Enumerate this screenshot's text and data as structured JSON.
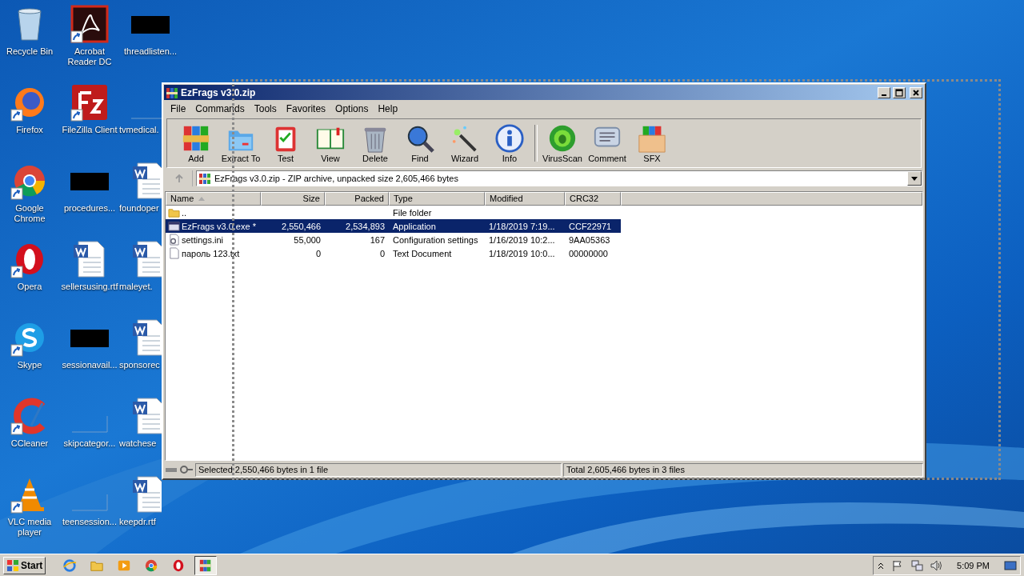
{
  "desktop_icons": [
    {
      "label": "Recycle Bin",
      "kind": "recycle",
      "shortcut": false
    },
    {
      "label": "Firefox",
      "kind": "firefox",
      "shortcut": true
    },
    {
      "label": "Google Chrome",
      "kind": "chrome",
      "shortcut": true
    },
    {
      "label": "Opera",
      "kind": "opera",
      "shortcut": true
    },
    {
      "label": "Skype",
      "kind": "skype",
      "shortcut": true
    },
    {
      "label": "CCleaner",
      "kind": "ccleaner",
      "shortcut": true
    },
    {
      "label": "VLC media player",
      "kind": "vlc",
      "shortcut": true
    },
    {
      "label": "Acrobat Reader DC",
      "kind": "acrobat",
      "shortcut": true
    },
    {
      "label": "FileZilla Client",
      "kind": "filezilla",
      "shortcut": true
    },
    {
      "label": "procedures...",
      "kind": "redacted",
      "shortcut": false
    },
    {
      "label": "sellersusing.rtf",
      "kind": "word",
      "shortcut": false
    },
    {
      "label": "sessionavail...",
      "kind": "redacted",
      "shortcut": false
    },
    {
      "label": "skipcategor...",
      "kind": "blank",
      "shortcut": false
    },
    {
      "label": "teensession...",
      "kind": "blank",
      "shortcut": false
    },
    {
      "label": "threadlisten...",
      "kind": "redacted",
      "shortcut": false
    },
    {
      "label": "tvmedical.",
      "kind": "blank",
      "shortcut": false
    },
    {
      "label": "foundoper",
      "kind": "word",
      "shortcut": false
    },
    {
      "label": "maleyet.",
      "kind": "word",
      "shortcut": false
    },
    {
      "label": "sponsorec",
      "kind": "word",
      "shortcut": false
    },
    {
      "label": "watchese",
      "kind": "word",
      "shortcut": false
    },
    {
      "label": "keepdr.rtf",
      "kind": "word",
      "shortcut": false
    }
  ],
  "window": {
    "title": "EzFrags v3.0.zip",
    "menu": [
      "File",
      "Commands",
      "Tools",
      "Favorites",
      "Options",
      "Help"
    ],
    "toolbar": {
      "groups": [
        {
          "buttons": [
            {
              "label": "Add",
              "kind": "add"
            },
            {
              "label": "Extract To",
              "kind": "extract"
            },
            {
              "label": "Test",
              "kind": "test"
            },
            {
              "label": "View",
              "kind": "view"
            },
            {
              "label": "Delete",
              "kind": "delete"
            },
            {
              "label": "Find",
              "kind": "find"
            },
            {
              "label": "Wizard",
              "kind": "wizard"
            },
            {
              "label": "Info",
              "kind": "info"
            }
          ]
        },
        {
          "buttons": [
            {
              "label": "VirusScan",
              "kind": "virus"
            },
            {
              "label": "Comment",
              "kind": "comment"
            },
            {
              "label": "SFX",
              "kind": "sfx"
            }
          ]
        }
      ]
    },
    "address": "EzFrags v3.0.zip - ZIP archive, unpacked size 2,605,466 bytes",
    "columns": [
      "Name",
      "Size",
      "Packed",
      "Type",
      "Modified",
      "CRC32"
    ],
    "rows": [
      {
        "kind": "folder",
        "name": "..",
        "size": "",
        "packed": "",
        "type": "File folder",
        "modified": "",
        "crc": "",
        "selected": false
      },
      {
        "kind": "app",
        "name": "EzFrags v3.0.exe *",
        "size": "2,550,466",
        "packed": "2,534,893",
        "type": "Application",
        "modified": "1/18/2019 7:19...",
        "crc": "CCF22971",
        "selected": true
      },
      {
        "kind": "ini",
        "name": "settings.ini",
        "size": "55,000",
        "packed": "167",
        "type": "Configuration settings",
        "modified": "1/16/2019 10:2...",
        "crc": "9AA05363",
        "selected": false
      },
      {
        "kind": "txt",
        "name": "пароль 123.txt",
        "size": "0",
        "packed": "0",
        "type": "Text Document",
        "modified": "1/18/2019 10:0...",
        "crc": "00000000",
        "selected": false
      }
    ],
    "status": {
      "left": "Selected 2,550,466 bytes in 1 file",
      "right": "Total 2,605,466 bytes in 3 files"
    }
  },
  "taskbar": {
    "start": "Start",
    "apps": [
      {
        "kind": "ie",
        "selected": false
      },
      {
        "kind": "explorer",
        "selected": false
      },
      {
        "kind": "media",
        "selected": false
      },
      {
        "kind": "chrome",
        "selected": false
      },
      {
        "kind": "opera",
        "selected": false
      },
      {
        "kind": "winrar",
        "selected": true
      }
    ],
    "clock": "5:09 PM"
  }
}
